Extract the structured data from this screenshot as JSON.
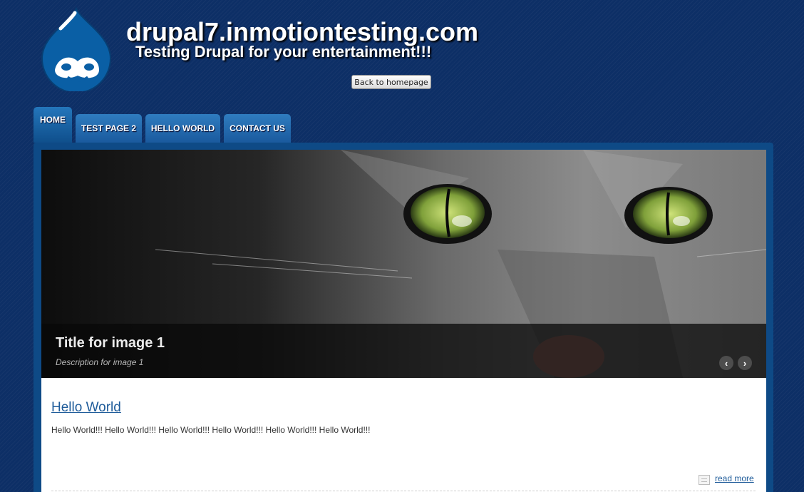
{
  "header": {
    "site_name": "drupal7.inmotiontesting.com",
    "slogan": "Testing Drupal for your entertainment!!!",
    "back_button": "Back to homepage",
    "logo_icon": "drupal-drop-logo"
  },
  "nav": {
    "tabs": [
      {
        "label": "HOME",
        "active": true
      },
      {
        "label": "TEST PAGE 2",
        "active": false
      },
      {
        "label": "HELLO WORLD",
        "active": false
      },
      {
        "label": "CONTACT US",
        "active": false
      }
    ]
  },
  "slideshow": {
    "title": "Title for image 1",
    "description": "Description for image 1",
    "prev_icon": "‹",
    "next_icon": "›"
  },
  "article": {
    "title": "Hello World",
    "body": "Hello World!!! Hello World!!! Hello World!!! Hello World!!! Hello World!!! Hello World!!!",
    "read_more": "read more"
  },
  "colors": {
    "background": "#0d2f66",
    "tab": "#1a5a9e",
    "link": "#1f5c9a"
  }
}
